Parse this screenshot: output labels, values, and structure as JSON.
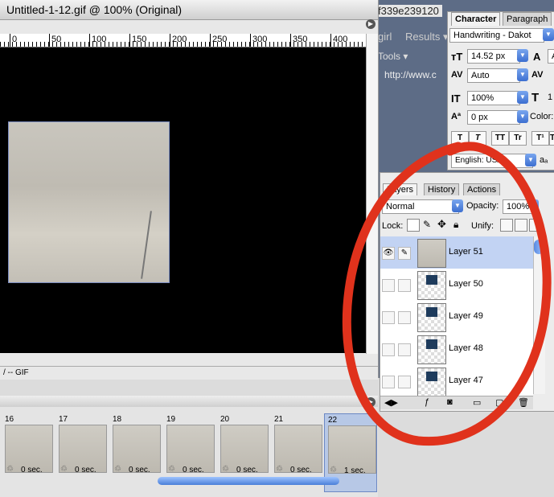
{
  "document": {
    "title": "Untitled-1-12.gif @ 100% (Original)",
    "ruler_labels": [
      "0",
      "50",
      "100",
      "150",
      "200",
      "250",
      "300",
      "350",
      "400"
    ],
    "status": "/ -- GIF"
  },
  "browser": {
    "url_fragment": "f339e239120",
    "girl": "girl",
    "results": "Results ▾",
    "tools": "Tools ▾",
    "url": "http://www.c"
  },
  "animation": {
    "frames": [
      {
        "num": "16",
        "delay": "0 sec."
      },
      {
        "num": "17",
        "delay": "0 sec."
      },
      {
        "num": "18",
        "delay": "0 sec."
      },
      {
        "num": "19",
        "delay": "0 sec."
      },
      {
        "num": "20",
        "delay": "0 sec."
      },
      {
        "num": "21",
        "delay": "0 sec."
      },
      {
        "num": "22",
        "delay": "1 sec."
      }
    ],
    "selected_frame": "22"
  },
  "character": {
    "tabs": [
      "Character",
      "Paragraph"
    ],
    "font_family": "Handwriting - Dakot",
    "font_size": "14.52 px",
    "leading_prefix": "A",
    "tracking": "Auto",
    "kerning_prefix": "AV",
    "vertical_scale": "100%",
    "horizontal_prefix": "1",
    "baseline_shift": "0 px",
    "color_label": "Color:",
    "language": "English: USA",
    "style_buttons": [
      "T",
      "T",
      "TT",
      "Tr",
      "T¹",
      "T"
    ]
  },
  "layers": {
    "tabs": [
      "Layers",
      "History",
      "Actions"
    ],
    "blend_mode": "Normal",
    "opacity_label": "Opacity:",
    "opacity": "100%",
    "lock_label": "Lock:",
    "unify_label": "Unify:",
    "rows": [
      {
        "name": "Layer 51",
        "selected": true
      },
      {
        "name": "Layer 50",
        "selected": false
      },
      {
        "name": "Layer 49",
        "selected": false
      },
      {
        "name": "Layer 48",
        "selected": false
      },
      {
        "name": "Layer 47",
        "selected": false
      }
    ]
  },
  "colors": {
    "annotation": "#e0321c",
    "canvas": "#000000",
    "selection": "#c2d3f3"
  }
}
